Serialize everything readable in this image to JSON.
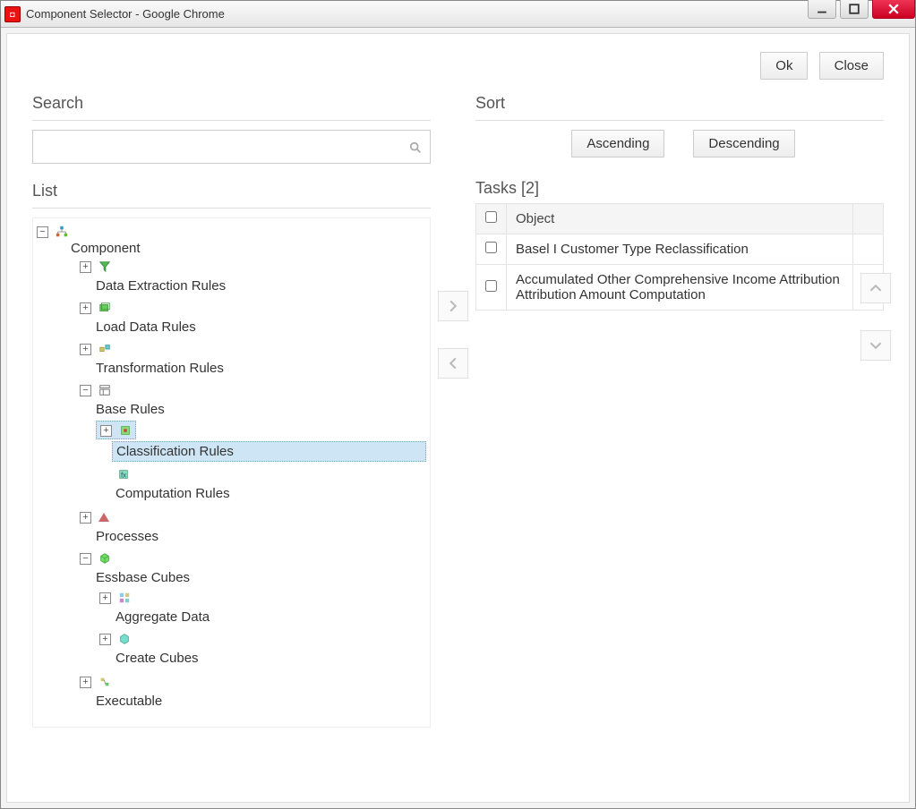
{
  "window": {
    "title": "Component Selector - Google Chrome"
  },
  "actions": {
    "ok": "Ok",
    "close": "Close"
  },
  "search": {
    "title": "Search",
    "value": "",
    "placeholder": ""
  },
  "list": {
    "title": "List"
  },
  "tree": {
    "root": "",
    "component": "Component",
    "data_extraction": "Data Extraction Rules",
    "load_data": "Load Data Rules",
    "transformation": "Transformation Rules",
    "base_rules": "Base Rules",
    "classification": "Classification Rules",
    "computation": "Computation Rules",
    "processes": "Processes",
    "essbase": "Essbase Cubes",
    "aggregate": "Aggregate Data",
    "create_cubes": "Create Cubes",
    "executable": "Executable"
  },
  "sort": {
    "title": "Sort",
    "asc": "Ascending",
    "desc": "Descending"
  },
  "tasks": {
    "title": "Tasks [2]",
    "header_object": "Object",
    "rows": [
      {
        "object": "Basel I Customer Type Reclassification"
      },
      {
        "object": "Accumulated Other Comprehensive Income Attribution Attribution Amount Computation"
      }
    ]
  }
}
